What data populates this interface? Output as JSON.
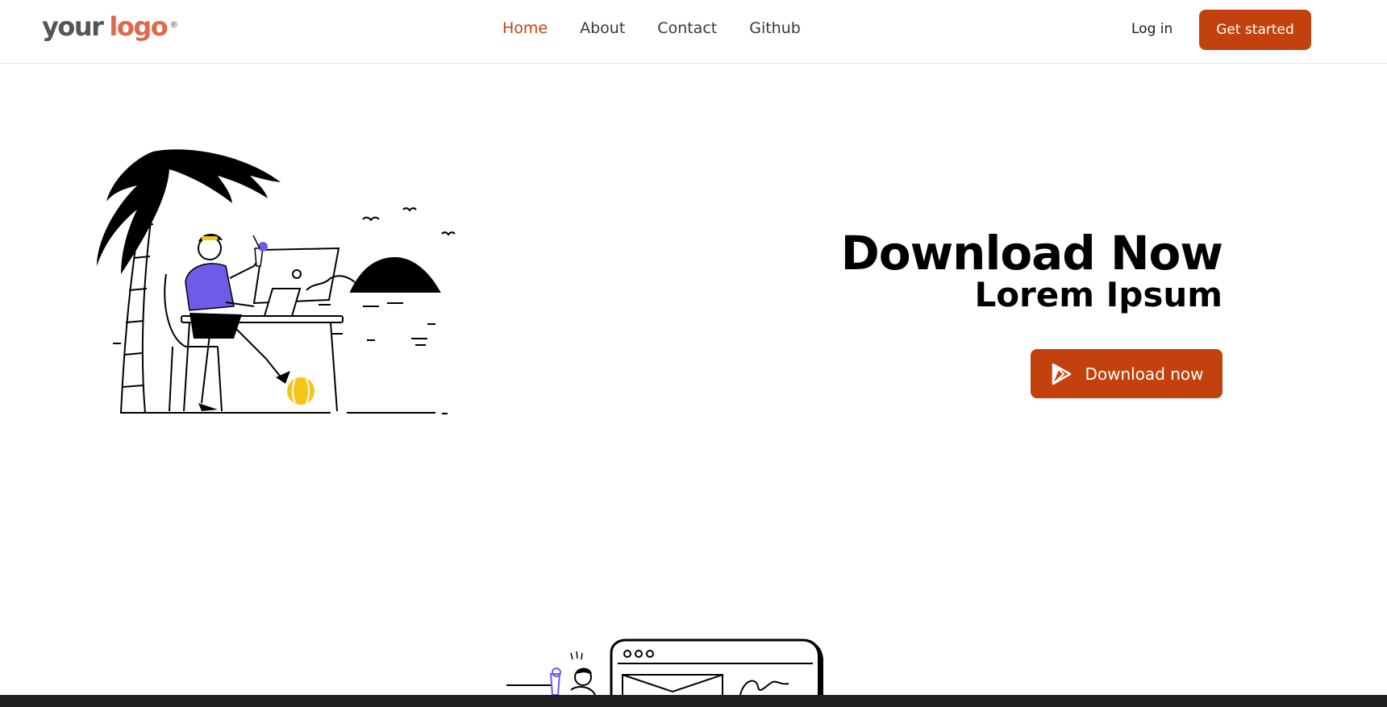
{
  "logo": {
    "part1": "your",
    "part2": "logo",
    "mark": "®"
  },
  "nav": {
    "links": [
      {
        "label": "Home",
        "active": true
      },
      {
        "label": "About",
        "active": false
      },
      {
        "label": "Contact",
        "active": false
      },
      {
        "label": "Github",
        "active": false
      }
    ],
    "login_label": "Log in",
    "cta_label": "Get started"
  },
  "hero": {
    "title": "Download Now",
    "subtitle": "Lorem Ipsum",
    "button_label": "Download now",
    "button_icon": "play-store-icon"
  },
  "colors": {
    "accent": "#c2410c",
    "logo_gray": "#555555",
    "logo_orange": "#e0684b",
    "illustration_purple": "#6c5ce7",
    "illustration_yellow": "#f5c518"
  }
}
